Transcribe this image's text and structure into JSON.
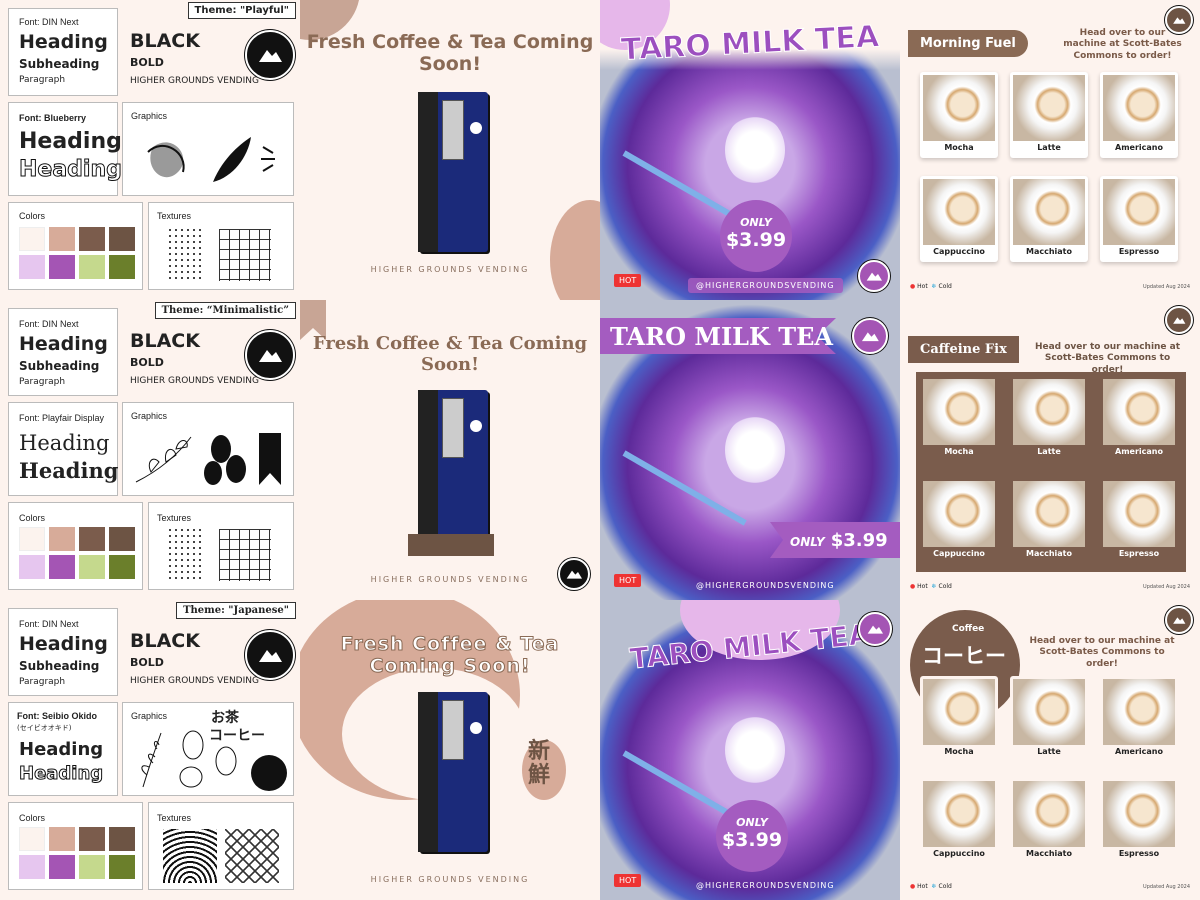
{
  "style_guides": [
    {
      "theme": "Theme: \"Playful\"",
      "font_label": "Font: DIN Next",
      "heading": "Heading",
      "subheading": "Subheading",
      "paragraph": "Paragraph",
      "black": "BLACK",
      "bold": "BOLD",
      "brand": "HIGHER GROUNDS VENDING",
      "font2_label": "Font: Blueberry",
      "heading2a": "Heading",
      "heading2b": "Heading",
      "graphics": "Graphics",
      "colors": "Colors",
      "textures": "Textures"
    },
    {
      "theme": "Theme: “Minimalistic”",
      "font_label": "Font: DIN Next",
      "heading": "Heading",
      "subheading": "Subheading",
      "paragraph": "Paragraph",
      "black": "BLACK",
      "bold": "BOLD",
      "brand": "HIGHER GROUNDS VENDING",
      "font2_label": "Font: Playfair Display",
      "heading2a": "Heading",
      "heading2b": "Heading",
      "graphics": "Graphics",
      "colors": "Colors",
      "textures": "Textures"
    },
    {
      "theme": "Theme: \"Japanese\"",
      "font_label": "Font: DIN Next",
      "heading": "Heading",
      "subheading": "Subheading",
      "paragraph": "Paragraph",
      "black": "BLACK",
      "bold": "BOLD",
      "brand": "HIGHER GROUNDS VENDING",
      "font2_label": "Font: Seibio Okido",
      "font2_sub": "(セイビオオキド)",
      "heading2a": "Heading",
      "heading2b": "Heading",
      "graphics": "Graphics",
      "jp1": "お茶",
      "jp2": "コーヒー",
      "colors": "Colors",
      "textures": "Textures"
    }
  ],
  "palette": [
    "#fcf3ee",
    "#d7ab99",
    "#7b5c4c",
    "#6d5444",
    "#e6c6ef",
    "#a455b4",
    "#c5d98d",
    "#6b7f2b"
  ],
  "promos": [
    {
      "title": "Fresh Coffee & Tea Coming Soon!",
      "caption": "HIGHER GROUNDS VENDING"
    },
    {
      "title": "Fresh Coffee & Tea Coming Soon!",
      "caption": "HIGHER GROUNDS VENDING"
    },
    {
      "title": "Fresh Coffee & Tea Coming Soon!",
      "caption": "HIGHER GROUNDS VENDING",
      "kanji": "新鮮"
    }
  ],
  "taro": [
    {
      "title": "TARO MILK TEA",
      "only": "ONLY",
      "price": "$3.99",
      "hot": "HOT",
      "handle": "@HIGHERGROUNDSVENDING"
    },
    {
      "title": "TARO MILK TEA",
      "only": "ONLY",
      "price": "$3.99",
      "hot": "HOT",
      "handle": "@HIGHERGROUNDSVENDING"
    },
    {
      "title": "TARO MILK TEA",
      "only": "ONLY",
      "price": "$3.99",
      "hot": "HOT",
      "handle": "@HIGHERGROUNDSVENDING"
    }
  ],
  "menus": [
    {
      "tab": "Morning Fuel",
      "hint": "Head over to our machine at Scott-Bates Commons to order!",
      "items": [
        "Mocha",
        "Latte",
        "Americano",
        "Cappuccino",
        "Macchiato",
        "Espresso"
      ],
      "hot": "Hot",
      "cold": "Cold",
      "updated": "Updated Aug 2024"
    },
    {
      "tab": "Caffeine Fix",
      "hint": "Head over to our machine at Scott-Bates Commons to order!",
      "items": [
        "Mocha",
        "Latte",
        "Americano",
        "Cappuccino",
        "Macchiato",
        "Espresso"
      ],
      "hot": "Hot",
      "cold": "Cold",
      "updated": "Updated Aug 2024"
    },
    {
      "tab": "Coffee",
      "tab_jp": "コーヒー",
      "hint": "Head over to our machine at Scott-Bates Commons to order!",
      "items": [
        "Mocha",
        "Latte",
        "Americano",
        "Cappuccino",
        "Macchiato",
        "Espresso"
      ],
      "hot": "Hot",
      "cold": "Cold",
      "updated": "Updated Aug 2024"
    }
  ]
}
